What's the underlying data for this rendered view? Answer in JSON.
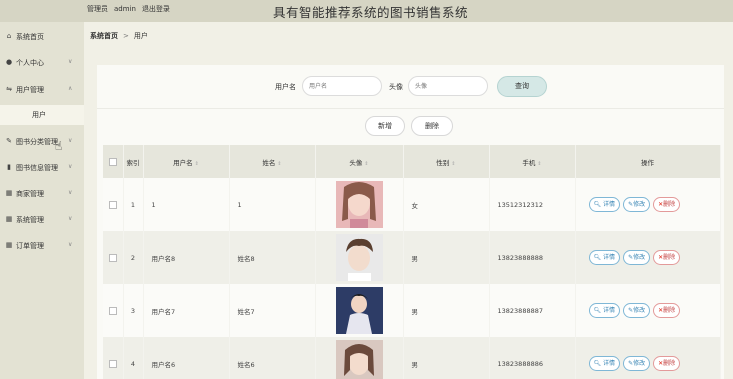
{
  "topbar": {
    "role": "管理员",
    "username": "admin",
    "logout": "退出登录",
    "title": "具有智能推荐系统的图书销售系统"
  },
  "sidebar": {
    "items": [
      {
        "label": "系统首页",
        "icon": "home-icon",
        "glyph": "⌂"
      },
      {
        "label": "个人中心",
        "icon": "person-icon",
        "glyph": "●"
      },
      {
        "label": "用户管理",
        "icon": "users-icon",
        "glyph": "⇋"
      },
      {
        "label": "图书分类管理",
        "icon": "pencil-icon",
        "glyph": "✎"
      },
      {
        "label": "图书信息管理",
        "icon": "bar-chart-icon",
        "glyph": "▮"
      },
      {
        "label": "商家管理",
        "icon": "grid-icon",
        "glyph": "▦"
      },
      {
        "label": "系统管理",
        "icon": "grid-icon",
        "glyph": "▦"
      },
      {
        "label": "订单管理",
        "icon": "grid-icon",
        "glyph": "▦"
      }
    ],
    "submenu_user": "用户"
  },
  "breadcrumb": {
    "home": "系统首页",
    "separator": ">",
    "current": "用户"
  },
  "search": {
    "username_label": "用户名",
    "username_placeholder": "用户名",
    "avatar_label": "头像",
    "avatar_placeholder": "头像",
    "query_button": "查询"
  },
  "actions": {
    "add": "新增",
    "delete": "删除"
  },
  "table": {
    "headers": {
      "index": "索引",
      "username": "用户名",
      "name": "姓名",
      "avatar": "头像",
      "gender": "性别",
      "phone": "手机",
      "ops": "操作"
    },
    "rows": [
      {
        "index": "1",
        "username": "1",
        "name": "1",
        "gender": "女",
        "phone": "13512312312"
      },
      {
        "index": "2",
        "username": "用户名8",
        "name": "姓名8",
        "gender": "男",
        "phone": "13823888888"
      },
      {
        "index": "3",
        "username": "用户名7",
        "name": "姓名7",
        "gender": "男",
        "phone": "13823888887"
      },
      {
        "index": "4",
        "username": "用户名6",
        "name": "姓名6",
        "gender": "男",
        "phone": "13823888886"
      }
    ],
    "op_labels": {
      "view": "详情",
      "edit": "修改",
      "delete": "删除"
    }
  },
  "colors": {
    "topbar": "#d6d5c4",
    "sidebar": "#e3e2d3",
    "query_button": "#d5e8e6",
    "view_blue": "#3a86b5",
    "delete_red": "#c24040"
  }
}
